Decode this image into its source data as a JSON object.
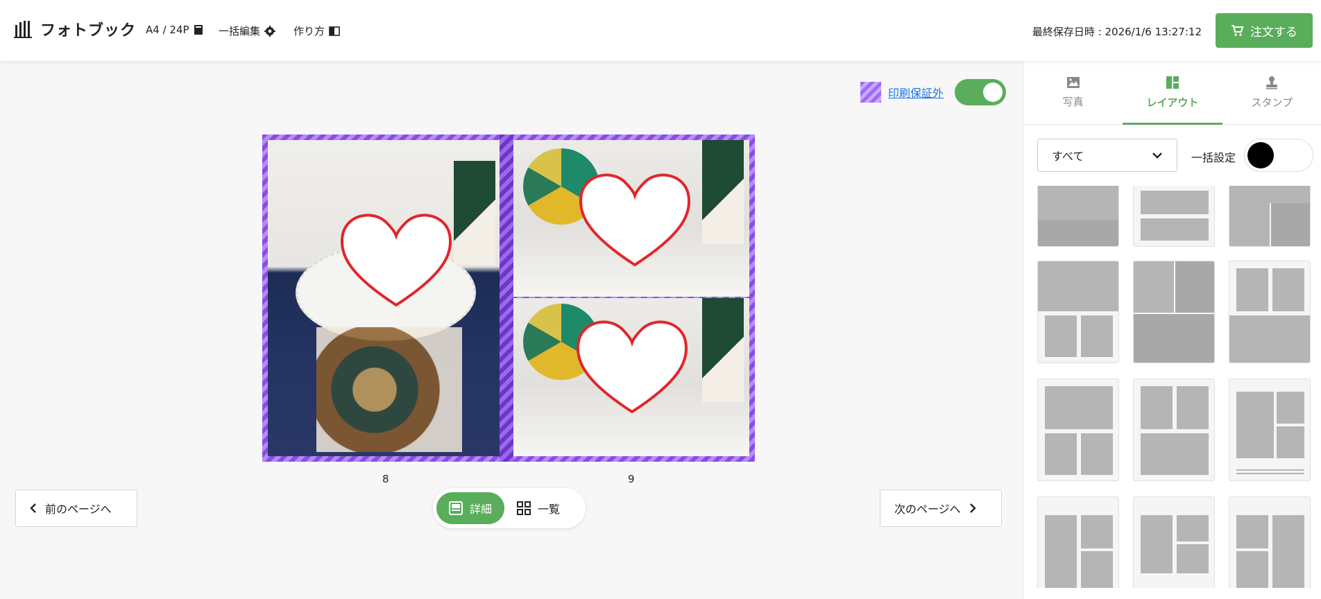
{
  "header": {
    "app_name": "フォトブック",
    "size_label": "A4 / 24P",
    "bulk_edit_label": "一括編集",
    "howto_label": "作り方",
    "last_saved_label": "最終保存日時 : 2026/1/6 13:27:12",
    "order_label": "注文する"
  },
  "canvas": {
    "print_guarantee_label": "印刷保証外",
    "print_guarantee_toggle_on": true,
    "pages": [
      {
        "number": "8"
      },
      {
        "number": "9"
      }
    ]
  },
  "footer": {
    "prev_label": "前のページへ",
    "next_label": "次のページへ",
    "view_detail_label": "詳細",
    "view_list_label": "一覧",
    "active_view": "詳細"
  },
  "panel": {
    "tabs": [
      {
        "label": "写真",
        "icon": "image-icon"
      },
      {
        "label": "レイアウト",
        "icon": "layout-icon",
        "active": true
      },
      {
        "label": "スタンプ",
        "icon": "stamp-icon"
      }
    ],
    "filter_value": "すべて",
    "bulk_setting_label": "一括設定"
  },
  "colors": {
    "accent": "#5aad5b",
    "print_stripe": "#9c6af2",
    "link": "#1a73e8"
  }
}
